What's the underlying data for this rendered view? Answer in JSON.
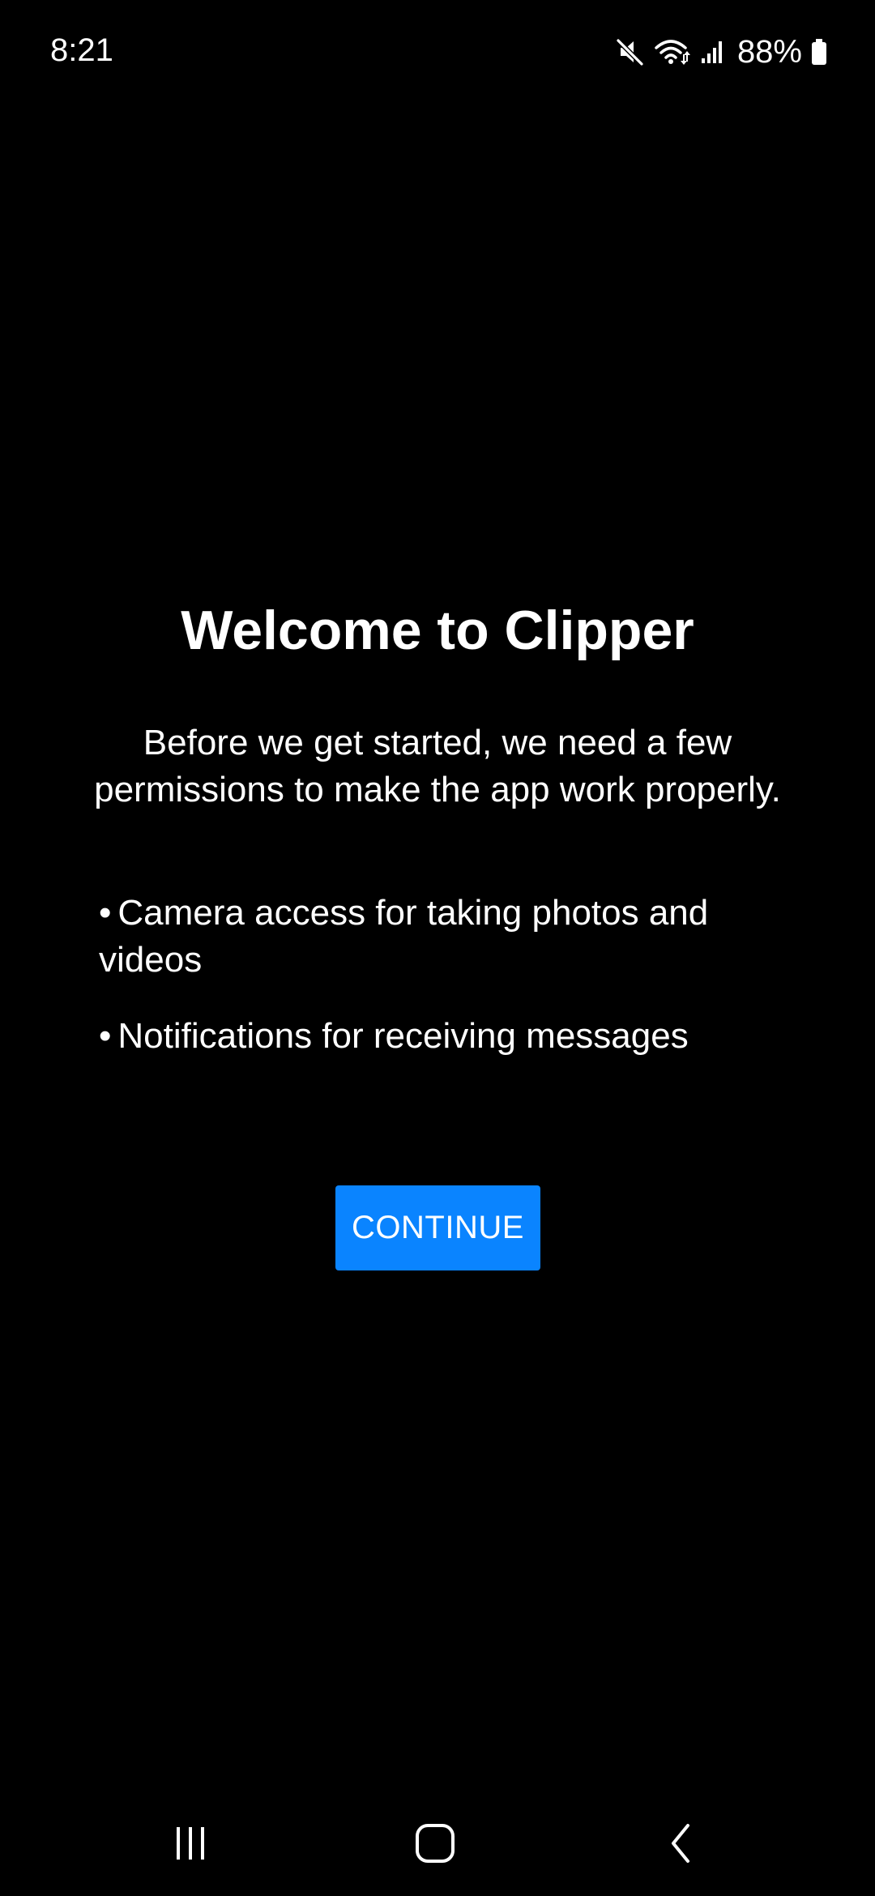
{
  "status_bar": {
    "time": "8:21",
    "battery_percent": "88%",
    "battery_level": 0.88,
    "icons": [
      "mute-icon",
      "wifi-icon",
      "signal-icon",
      "battery-icon"
    ]
  },
  "welcome": {
    "title": "Welcome to Clipper",
    "intro": "Before we get started, we need a few permissions to make the app work properly.",
    "permissions": [
      {
        "bullet": "•",
        "text": "Camera access for taking photos and videos"
      },
      {
        "bullet": "•",
        "text": "Notifications for receiving messages"
      }
    ],
    "continue_label": "CONTINUE"
  },
  "nav_bar": {
    "icons": [
      "recents-icon",
      "home-icon",
      "back-icon"
    ]
  },
  "colors": {
    "background": "#000000",
    "text": "#ffffff",
    "accent": "#0a84ff"
  }
}
